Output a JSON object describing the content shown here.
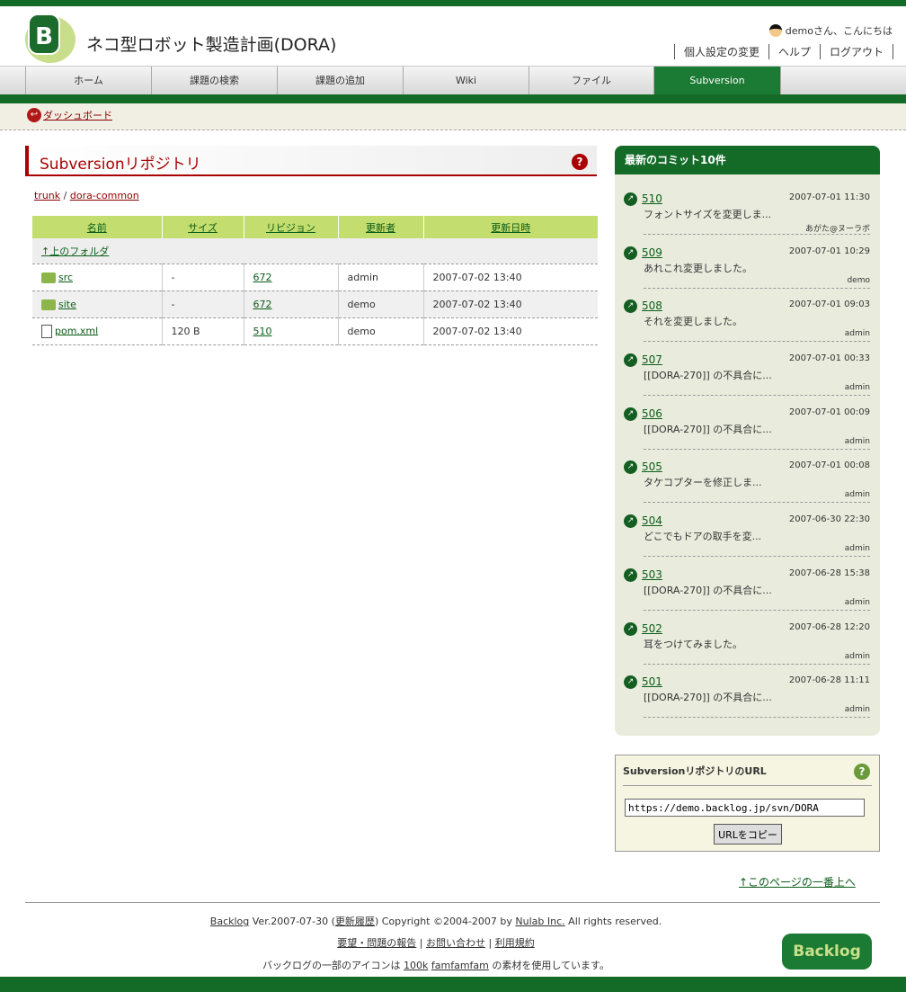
{
  "header": {
    "project_title": "ネコ型ロボット製造計画(DORA)",
    "greeting": "demoさん、こんにちは",
    "links": [
      "個人設定の変更",
      "ヘルプ",
      "ログアウト"
    ]
  },
  "nav": {
    "tabs": [
      "ホーム",
      "課題の検索",
      "課題の追加",
      "Wiki",
      "ファイル",
      "Subversion"
    ],
    "active": "Subversion"
  },
  "breadcrumb": {
    "dashboard": "ダッシュボード"
  },
  "main": {
    "title": "Subversionリポジトリ",
    "path": [
      "trunk",
      "dora-common"
    ],
    "path_sep": "/",
    "columns": [
      "名前",
      "サイズ",
      "リビジョン",
      "更新者",
      "更新日時"
    ],
    "up_folder": "↑上のフォルダ",
    "rows": [
      {
        "type": "folder",
        "name": "src",
        "size": "-",
        "revision": "672",
        "author": "admin",
        "date": "2007-07-02 13:40"
      },
      {
        "type": "folder",
        "name": "site",
        "size": "-",
        "revision": "672",
        "author": "demo",
        "date": "2007-07-02 13:40"
      },
      {
        "type": "file",
        "name": "pom.xml",
        "size": "120 B",
        "revision": "510",
        "author": "demo",
        "date": "2007-07-02 13:40"
      }
    ]
  },
  "sidebar": {
    "title": "最新のコミット10件",
    "commits": [
      {
        "rev": "510",
        "date": "2007-07-01 11:30",
        "msg": "フォントサイズを変更しま...",
        "author": "あがた@ヌーラボ"
      },
      {
        "rev": "509",
        "date": "2007-07-01 10:29",
        "msg": "あれこれ変更しました。",
        "author": "demo"
      },
      {
        "rev": "508",
        "date": "2007-07-01 09:03",
        "msg": "それを変更しました。",
        "author": "admin"
      },
      {
        "rev": "507",
        "date": "2007-07-01 00:33",
        "msg": "[[DORA-270]] の不具合に...",
        "author": "admin"
      },
      {
        "rev": "506",
        "date": "2007-07-01 00:09",
        "msg": "[[DORA-270]] の不具合に...",
        "author": "admin"
      },
      {
        "rev": "505",
        "date": "2007-07-01 00:08",
        "msg": "タケコプターを修正しま...",
        "author": "admin"
      },
      {
        "rev": "504",
        "date": "2007-06-30 22:30",
        "msg": "どこでもドアの取手を変...",
        "author": "admin"
      },
      {
        "rev": "503",
        "date": "2007-06-28 15:38",
        "msg": "[[DORA-270]] の不具合に...",
        "author": "admin"
      },
      {
        "rev": "502",
        "date": "2007-06-28 12:20",
        "msg": "耳をつけてみました。",
        "author": "admin"
      },
      {
        "rev": "501",
        "date": "2007-06-28 11:11",
        "msg": "[[DORA-270]] の不具合に...",
        "author": "admin"
      }
    ]
  },
  "url_box": {
    "title": "SubversionリポジトリのURL",
    "url": "https://demo.backlog.jp/svn/DORA",
    "copy_label": "URLをコピー"
  },
  "to_top": "↑このページの一番上へ",
  "footer": {
    "backlog": "Backlog",
    "version": " Ver.2007-07-30 (",
    "history": "更新履歴",
    "copyright": ") Copyright ©2004-2007 by ",
    "nulab": "Nulab Inc.",
    "rights": " All rights reserved.",
    "report": "要望・問題の報告",
    "contact": "お問い合わせ",
    "terms": "利用規約",
    "sep": " | ",
    "icons_pre": "バックログの一部のアイコンは ",
    "k100": "100k",
    "famfamfam": "famfamfam",
    "icons_post": " の素材を使用しています。",
    "logo_text": "Backlog"
  }
}
